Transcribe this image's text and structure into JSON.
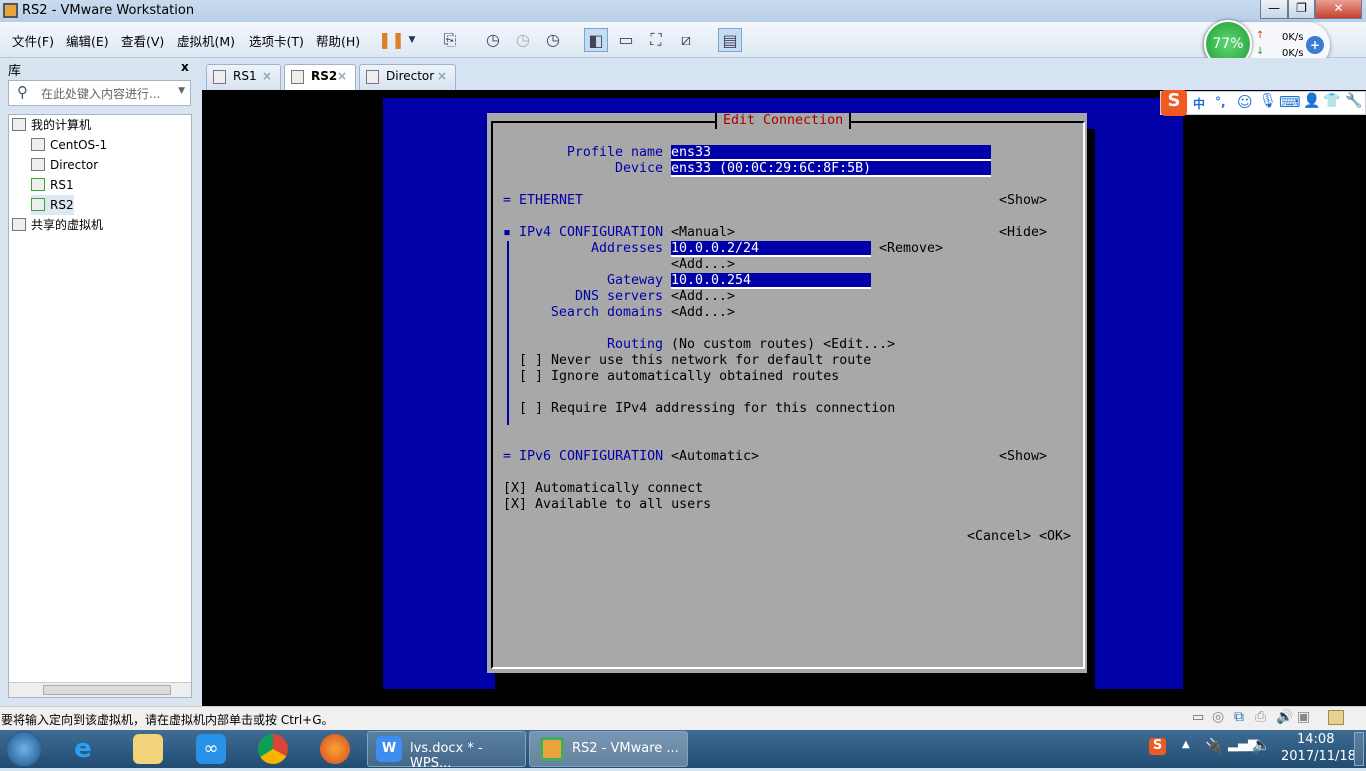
{
  "window": {
    "title": "RS2 - VMware Workstation",
    "minimize": "—",
    "restore": "❐",
    "close": "✕"
  },
  "menu": [
    "文件(F)",
    "编辑(E)",
    "查看(V)",
    "虚拟机(M)",
    "选项卡(T)",
    "帮助(H)"
  ],
  "toolbar_icons": [
    "pause-icon",
    "send-keys-icon",
    "snapshot-icon",
    "revert-snapshot-icon",
    "snapshot-manager-icon",
    "console-view-icon",
    "thumbnail-icon",
    "fullscreen-icon",
    "unity-icon",
    "library-toggle-icon"
  ],
  "net_widget": {
    "percent": "77%",
    "up": "0K/s",
    "down": "0K/s"
  },
  "library": {
    "title": "库",
    "close": "x",
    "search_placeholder": "在此处键入内容进行...",
    "tree": [
      {
        "label": "我的计算机",
        "level": 0
      },
      {
        "label": "CentOS-1",
        "level": 1
      },
      {
        "label": "Director",
        "level": 1
      },
      {
        "label": "RS1",
        "level": 1
      },
      {
        "label": "RS2",
        "level": 1
      },
      {
        "label": "共享的虚拟机",
        "level": 0
      }
    ]
  },
  "tabs": [
    {
      "label": "RS1",
      "active": false
    },
    {
      "label": "RS2",
      "active": true
    },
    {
      "label": "Director",
      "active": false
    }
  ],
  "ime_bar": {
    "lang": "中",
    "punct": "°,"
  },
  "tui": {
    "title": "Edit Connection",
    "profile_label": "Profile name",
    "profile_value": "ens33",
    "device_label": "Device",
    "device_value": "ens33 (00:0C:29:6C:8F:5B)",
    "ethernet": "= ETHERNET",
    "ethernet_toggle": "<Show>",
    "ipv4": "▪ IPv4 CONFIGURATION",
    "ipv4_mode": "<Manual>",
    "ipv4_toggle": "<Hide>",
    "addresses_label": "Addresses",
    "address_value": "10.0.0.2/24",
    "remove": "<Remove>",
    "add": "<Add...>",
    "gateway_label": "Gateway",
    "gateway_value": "10.0.0.254",
    "dns_label": "DNS servers",
    "search_label": "Search domains",
    "routing_label": "Routing",
    "routing_value": "(No custom routes) <Edit...>",
    "never_default": "[ ] Never use this network for default route",
    "ignore_routes": "[ ] Ignore automatically obtained routes",
    "require_ipv4": "[ ] Require IPv4 addressing for this connection",
    "ipv6": "= IPv6 CONFIGURATION",
    "ipv6_mode": "<Automatic>",
    "ipv6_toggle": "<Show>",
    "auto_connect": "[X] Automatically connect",
    "all_users": "[X] Available to all users",
    "cancel": "<Cancel>",
    "ok": "<OK>"
  },
  "status_text": "要将输入定向到该虚拟机，请在虚拟机内部单击或按 Ctrl+G。",
  "taskbar": {
    "buttons": [
      "lvs.docx * - WPS...",
      "RS2 - VMware ..."
    ],
    "time": "14:08",
    "date": "2017/11/18"
  },
  "colors": {
    "tui_blue": "#0000a8",
    "tui_grey": "#a8a8a8",
    "tui_title_red": "#a80000"
  }
}
